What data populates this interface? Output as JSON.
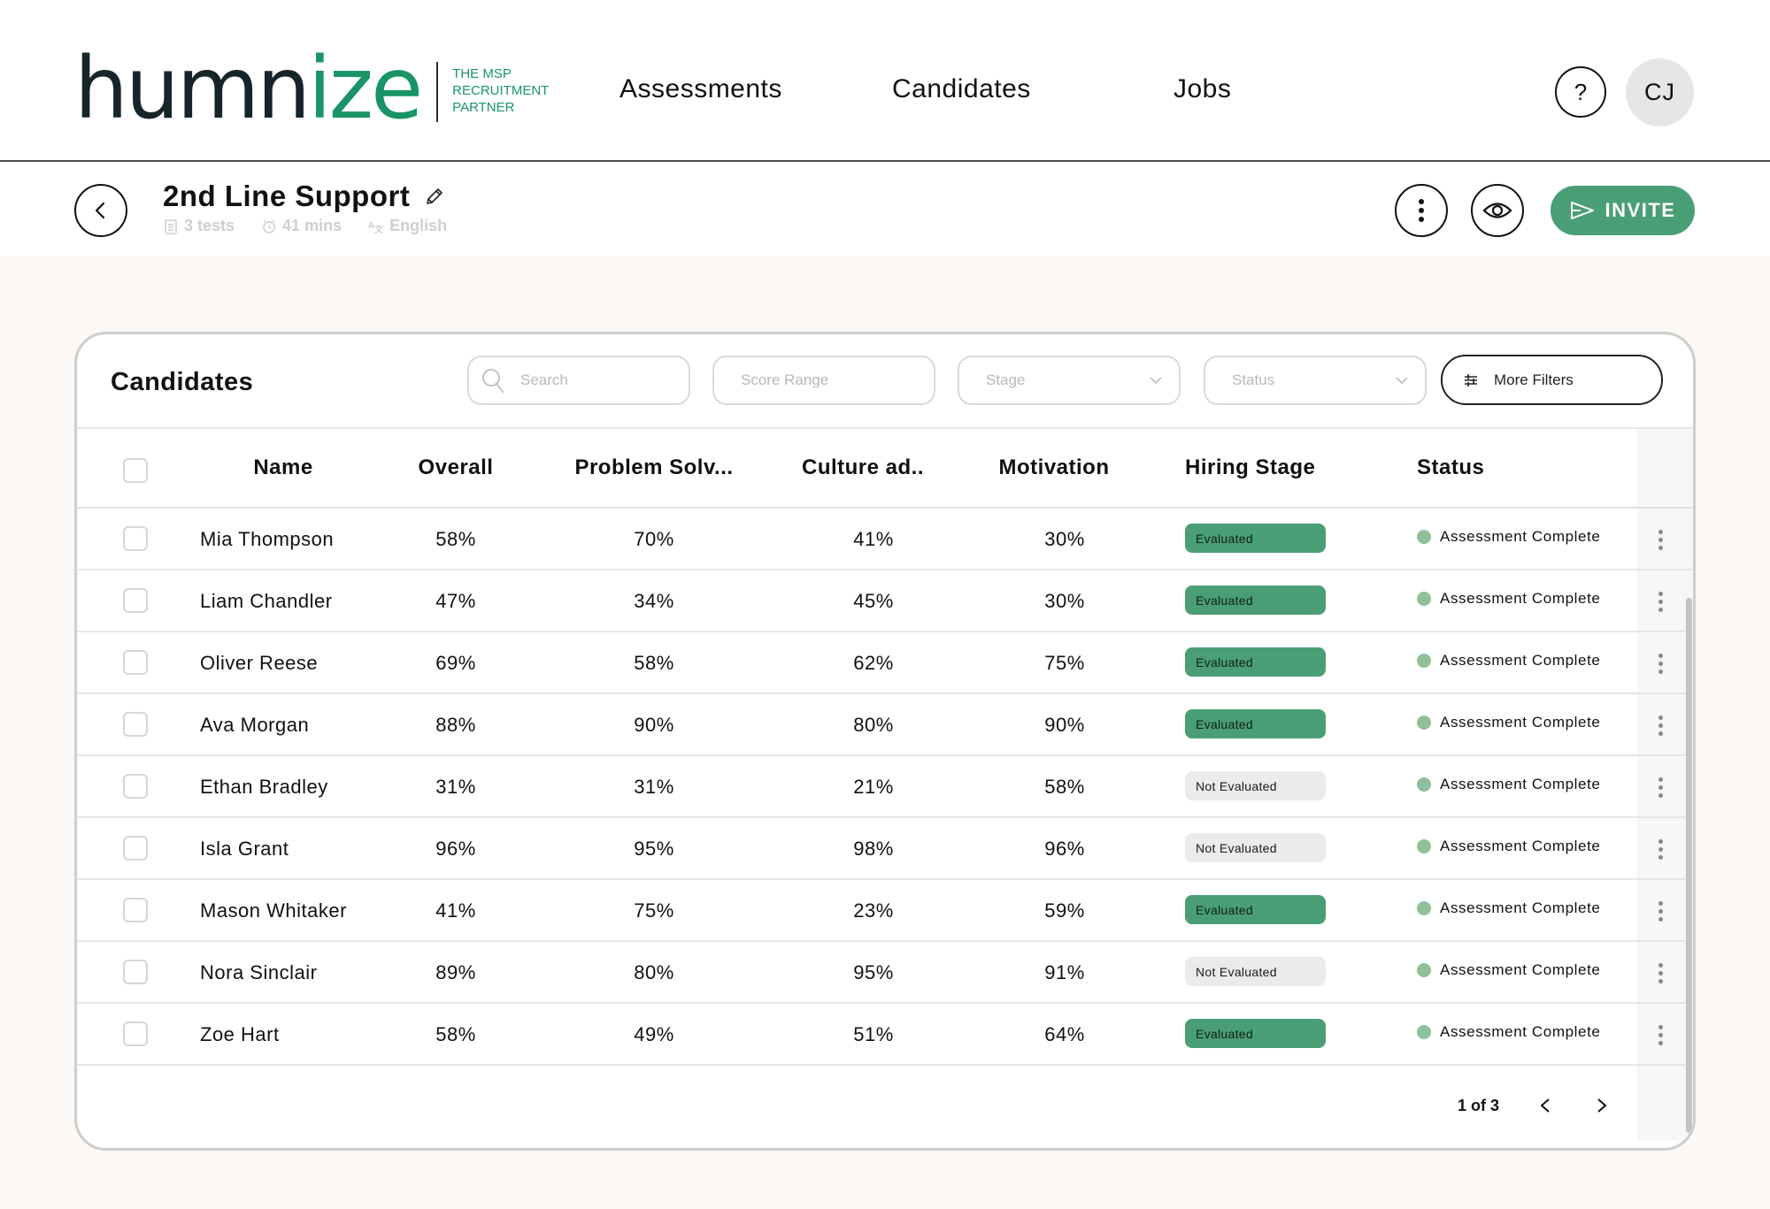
{
  "brand": {
    "name_dark": "humn",
    "name_green": "ize",
    "tagline": [
      "THE MSP",
      "RECRUITMENT",
      "PARTNER"
    ],
    "accent_color": "#1a9467"
  },
  "nav": {
    "links": [
      {
        "label": "Assessments"
      },
      {
        "label": "Candidates"
      },
      {
        "label": "Jobs"
      }
    ],
    "help_label": "?",
    "avatar_initials": "CJ"
  },
  "assessment": {
    "title": "2nd Line Support",
    "tests": "3 tests",
    "duration": "41 mins",
    "language": "English",
    "invite_label": "INVITE",
    "invite_color": "#4a9e76"
  },
  "candidates": {
    "title": "Candidates",
    "filters": {
      "search_placeholder": "Search",
      "score_range_placeholder": "Score Range",
      "stage_placeholder": "Stage",
      "status_placeholder": "Status",
      "more_filters_label": "More Filters"
    },
    "columns": [
      "Name",
      "Overall",
      "Problem Solv...",
      "Culture ad..",
      "Motivation",
      "Hiring Stage",
      "Status"
    ],
    "rows": [
      {
        "name": "Mia Thompson",
        "overall": "58%",
        "problem_solving": "70%",
        "culture": "41%",
        "motivation": "30%",
        "stage": "Evaluated",
        "status": "Assessment Complete"
      },
      {
        "name": "Liam Chandler",
        "overall": "47%",
        "problem_solving": "34%",
        "culture": "45%",
        "motivation": "30%",
        "stage": "Evaluated",
        "status": "Assessment Complete"
      },
      {
        "name": "Oliver Reese",
        "overall": "69%",
        "problem_solving": "58%",
        "culture": "62%",
        "motivation": "75%",
        "stage": "Evaluated",
        "status": "Assessment Complete"
      },
      {
        "name": "Ava Morgan",
        "overall": "88%",
        "problem_solving": "90%",
        "culture": "80%",
        "motivation": "90%",
        "stage": "Evaluated",
        "status": "Assessment Complete"
      },
      {
        "name": "Ethan Bradley",
        "overall": "31%",
        "problem_solving": "31%",
        "culture": "21%",
        "motivation": "58%",
        "stage": "Not Evaluated",
        "status": "Assessment Complete"
      },
      {
        "name": "Isla Grant",
        "overall": "96%",
        "problem_solving": "95%",
        "culture": "98%",
        "motivation": "96%",
        "stage": "Not Evaluated",
        "status": "Assessment Complete"
      },
      {
        "name": "Mason Whitaker",
        "overall": "41%",
        "problem_solving": "75%",
        "culture": "23%",
        "motivation": "59%",
        "stage": "Evaluated",
        "status": "Assessment Complete"
      },
      {
        "name": "Nora Sinclair",
        "overall": "89%",
        "problem_solving": "80%",
        "culture": "95%",
        "motivation": "91%",
        "stage": "Not Evaluated",
        "status": "Assessment Complete"
      },
      {
        "name": "Zoe Hart",
        "overall": "58%",
        "problem_solving": "49%",
        "culture": "51%",
        "motivation": "64%",
        "stage": "Evaluated",
        "status": "Assessment Complete"
      }
    ],
    "pagination": "1 of 3",
    "colors": {
      "evaluated": "#4a9e76",
      "not_evaluated": "#ebebeb",
      "status_dot": "#8ec09a"
    }
  }
}
